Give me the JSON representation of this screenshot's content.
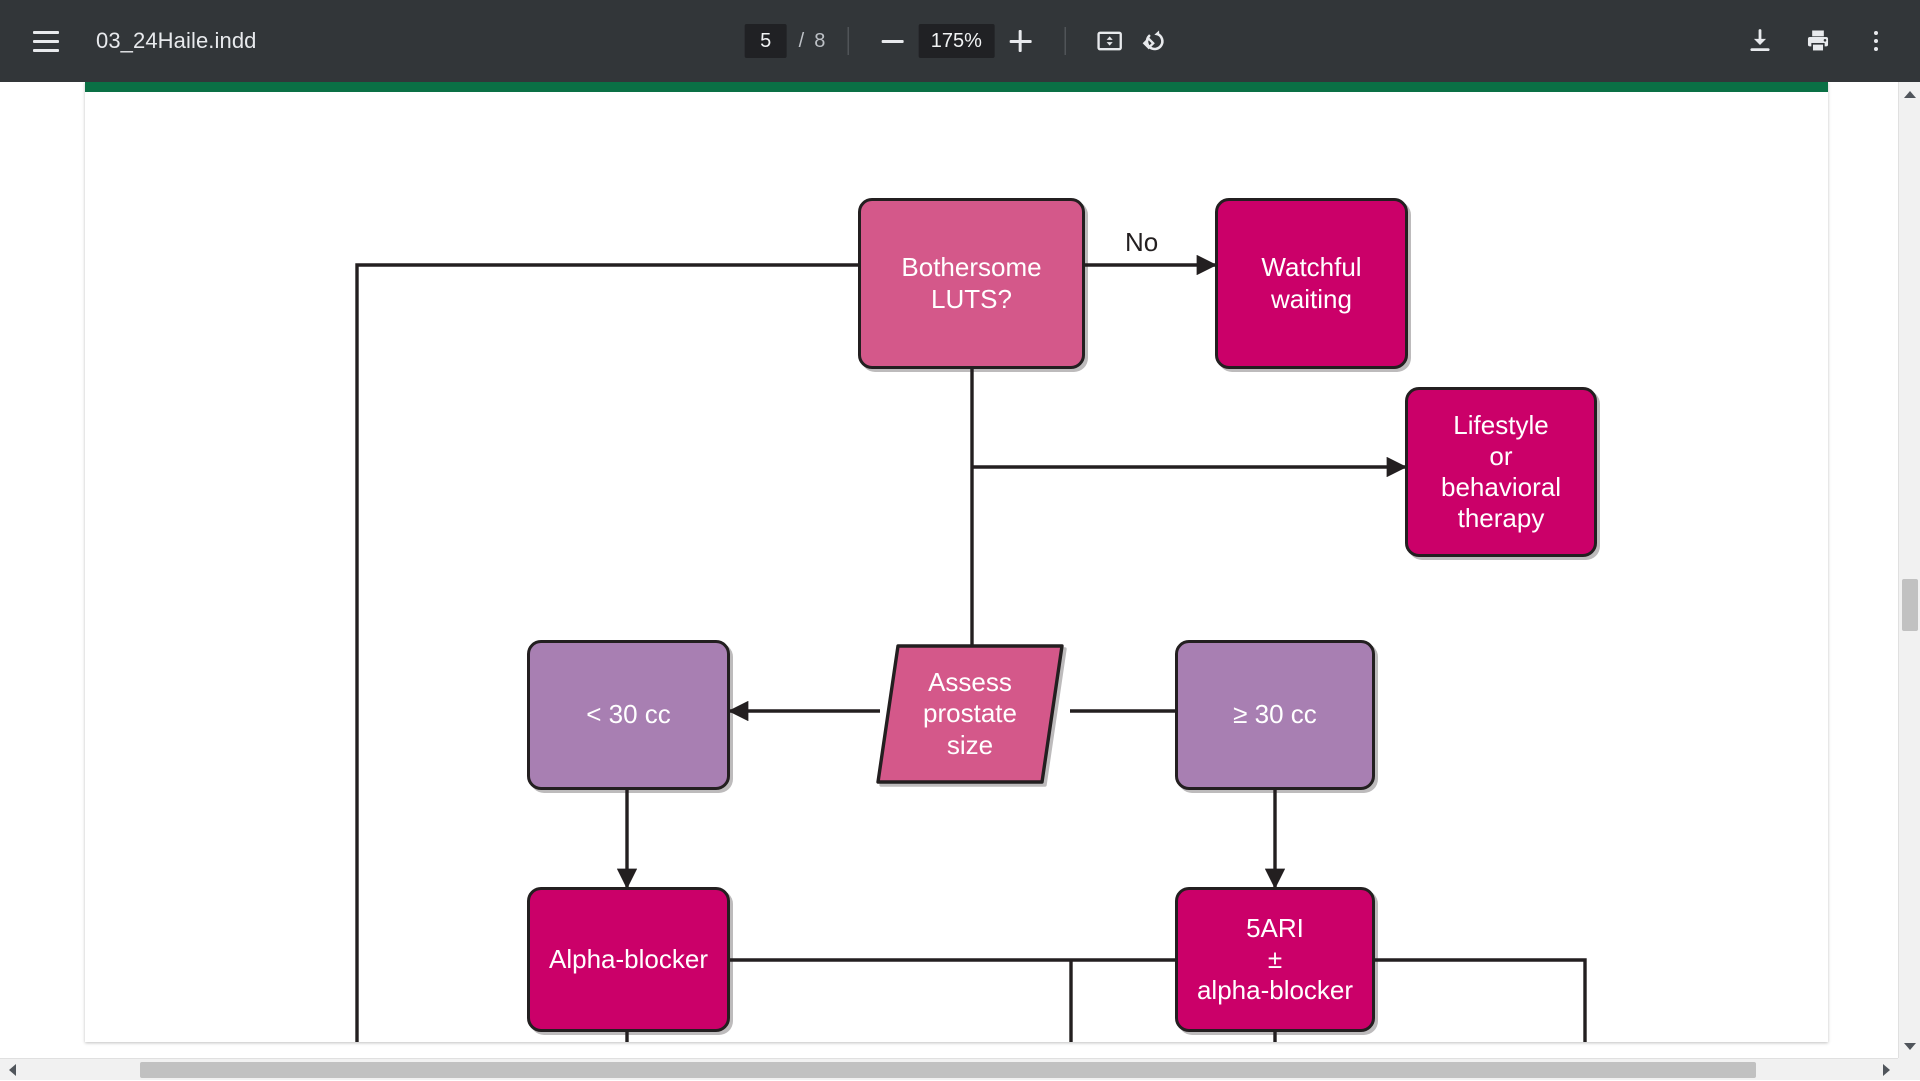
{
  "toolbar": {
    "menu_icon": "hamburger-menu-icon",
    "document_title": "03_24Haile.indd",
    "page_number_value": "5",
    "page_separator": "/",
    "page_count": "8",
    "zoom_out_icon": "minus-icon",
    "zoom_level": "175%",
    "zoom_in_icon": "plus-icon",
    "fit_icon": "fit-to-page-icon",
    "rotate_icon": "rotate-counterclockwise-icon",
    "download_icon": "download-icon",
    "print_icon": "print-icon",
    "more_icon": "more-vertical-icon",
    "bg_color": "#323639",
    "text_color": "#e8eaed"
  },
  "document": {
    "accent_band_color": "#0a7045",
    "page_background": "#ffffff"
  },
  "flowchart": {
    "colors": {
      "pink_light": "#d4588a",
      "magenta": "#cb0069",
      "purple": "#a87fb2",
      "outline": "#231f20",
      "label_text": "#ffffff"
    },
    "nodes": [
      {
        "id": "bothersome-luts",
        "label": "Bothersome\nLUTS?",
        "shape": "rounded-rect",
        "fill": "pink_light"
      },
      {
        "id": "watchful-waiting",
        "label": "Watchful\nwaiting",
        "shape": "rounded-rect",
        "fill": "magenta"
      },
      {
        "id": "lifestyle-therapy",
        "label": "Lifestyle\nor\nbehavioral\ntherapy",
        "shape": "rounded-rect",
        "fill": "magenta"
      },
      {
        "id": "assess-prostate",
        "label": "Assess\nprostate\nsize",
        "shape": "parallelogram",
        "fill": "pink_light"
      },
      {
        "id": "less-30cc",
        "label": "< 30 cc",
        "shape": "rounded-rect",
        "fill": "purple"
      },
      {
        "id": "ge-30cc",
        "label": "≥ 30 cc",
        "shape": "rounded-rect",
        "fill": "purple"
      },
      {
        "id": "alpha-blocker",
        "label": "Alpha-blocker",
        "shape": "rounded-rect",
        "fill": "magenta"
      },
      {
        "id": "5ari-alpha",
        "label": "5ARI\n±\nalpha-blocker",
        "shape": "rounded-rect",
        "fill": "magenta"
      }
    ],
    "edge_labels": [
      {
        "id": "no-label",
        "text": "No"
      }
    ],
    "node_text": {
      "bothersome_line1": "Bothersome",
      "bothersome_line2": "LUTS?",
      "watchful_line1": "Watchful",
      "watchful_line2": "waiting",
      "lifestyle_line1": "Lifestyle",
      "lifestyle_line2": "or",
      "lifestyle_line3": "behavioral",
      "lifestyle_line4": "therapy",
      "assess_line1": "Assess",
      "assess_line2": "prostate",
      "assess_line3": "size",
      "less30": "< 30 cc",
      "ge30": "≥ 30 cc",
      "alpha_blocker": "Alpha-blocker",
      "fiveari_line1": "5ARI",
      "fiveari_line2": "±",
      "fiveari_line3": "alpha-blocker",
      "no": "No"
    }
  },
  "scrollbars": {
    "vertical_up_icon": "scroll-up-arrow-icon",
    "vertical_down_icon": "scroll-down-arrow-icon",
    "horizontal_left_icon": "scroll-left-arrow-icon",
    "horizontal_right_icon": "scroll-right-arrow-icon",
    "track_color": "#f1f1f1",
    "thumb_color": "#c1c1c1"
  }
}
